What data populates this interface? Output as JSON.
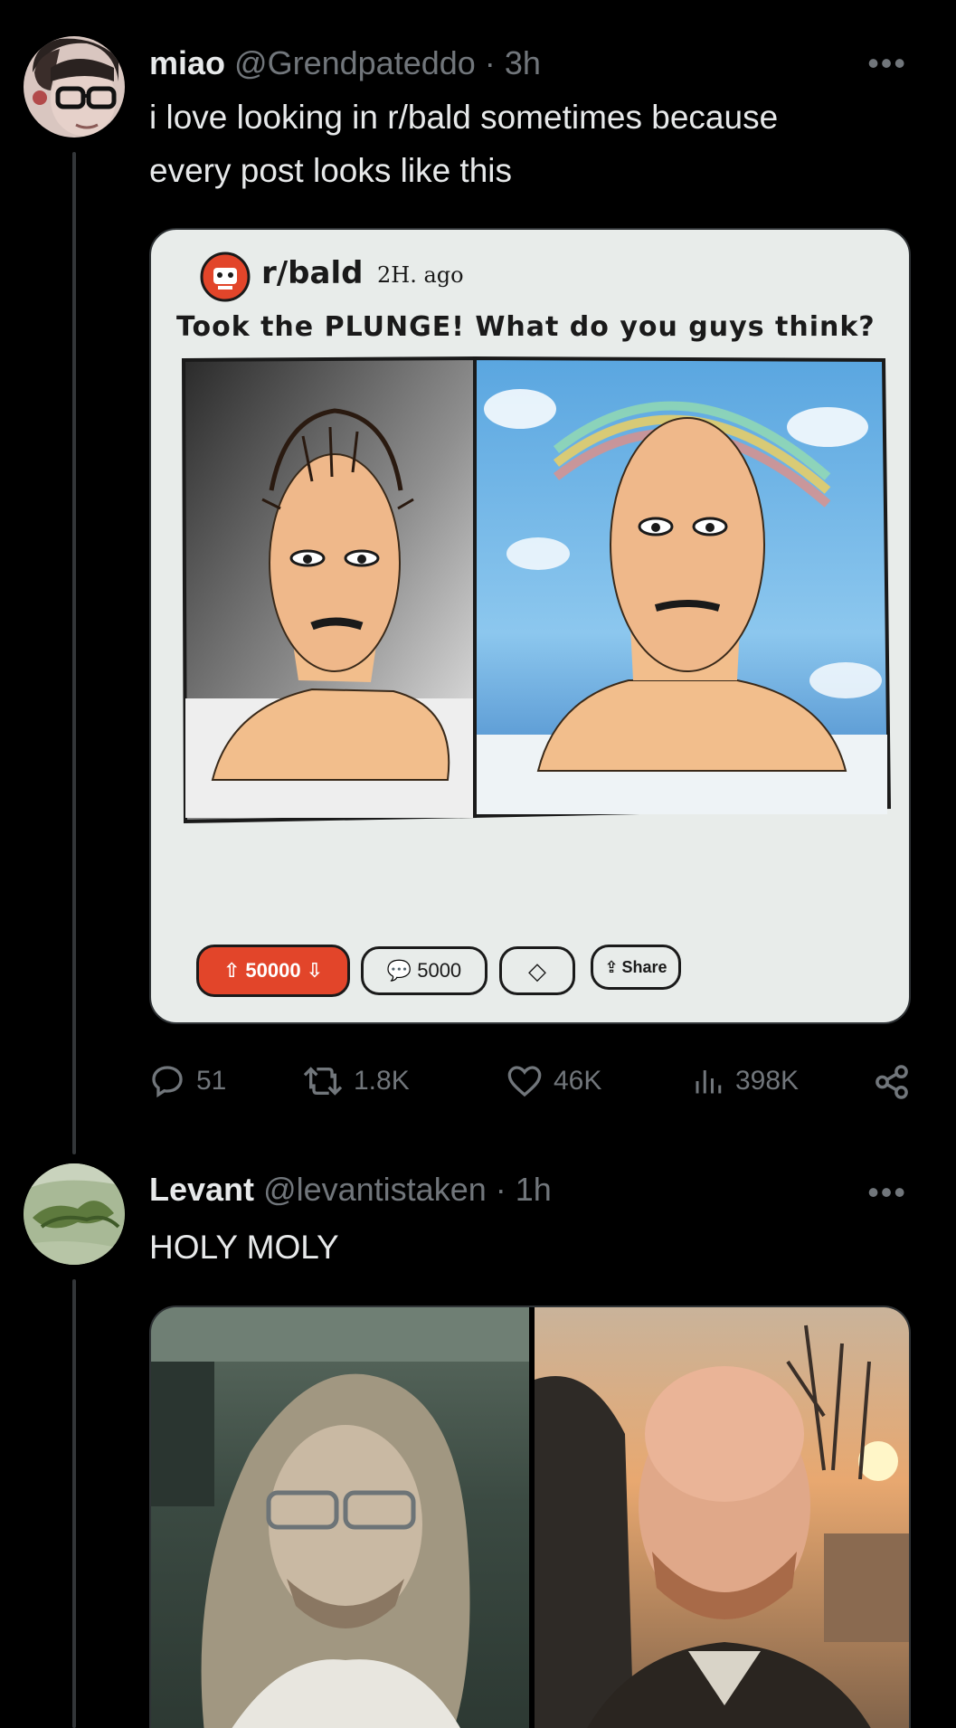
{
  "tweet1": {
    "name": "miao",
    "handle": "@Grendpateddo",
    "separator": "·",
    "time": "3h",
    "text_line1": "i love looking in r/bald sometimes because",
    "text_line2": "every post looks like this",
    "more_icon": "more-icon",
    "comic": {
      "subreddit": "r/bald",
      "age": "2H. ago",
      "caption": "Took the PLUNGE! What do you guys think?",
      "votes": "50000",
      "comments": "5000",
      "share": "Share"
    },
    "stats": {
      "replies": "51",
      "retweets": "1.8K",
      "likes": "46K",
      "views": "398K"
    }
  },
  "tweet2": {
    "name": "Levant",
    "handle": "@levantistaken",
    "separator": "·",
    "time": "1h",
    "text": "HOLY MOLY"
  },
  "colors": {
    "background": "#000000",
    "text": "#e7e9ea",
    "muted": "#71767b",
    "reddit_orange": "#e2452a"
  }
}
